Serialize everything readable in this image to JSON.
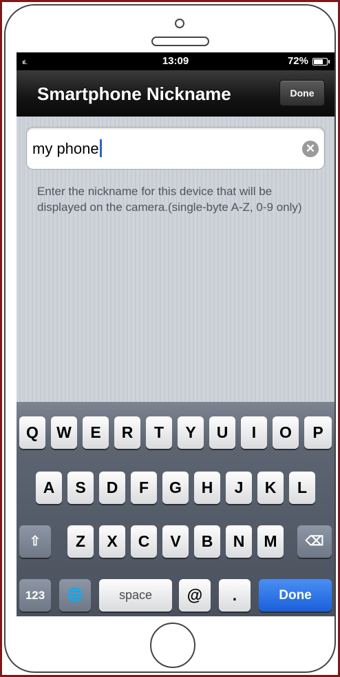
{
  "status_bar": {
    "signal": "ııl..",
    "time": "13:09",
    "battery": "72%"
  },
  "nav_bar": {
    "title": "Smartphone Nickname",
    "done_label": "Done"
  },
  "nickname_field": {
    "value": "my phone",
    "clear_icon": "clear-icon"
  },
  "hint_text": "Enter the nickname for this device that will be displayed on the camera.(single-byte A-Z, 0-9 only)",
  "keyboard": {
    "row1": [
      "Q",
      "W",
      "E",
      "R",
      "T",
      "Y",
      "U",
      "I",
      "O",
      "P"
    ],
    "row2": [
      "A",
      "S",
      "D",
      "F",
      "G",
      "H",
      "J",
      "K",
      "L"
    ],
    "row3": [
      "Z",
      "X",
      "C",
      "V",
      "B",
      "N",
      "M"
    ],
    "shift_glyph": "⇧",
    "backspace_glyph": "⌫",
    "numbers_label": "123",
    "globe_glyph": "🌐",
    "space_label": "space",
    "at_label": "@",
    "dot_label": ".",
    "done_label": "Done"
  },
  "colors": {
    "accent_blue": "#1a5fdc",
    "nav_bar": "#141414",
    "frame": "#7a1a1a"
  }
}
